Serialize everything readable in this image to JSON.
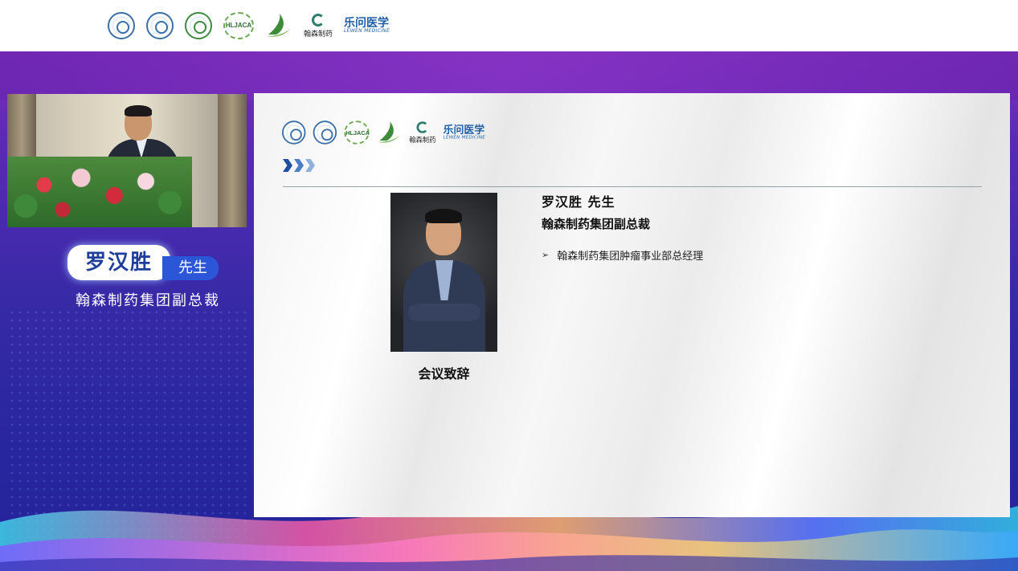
{
  "header": {
    "logos": [
      "seal-logo",
      "seal-logo",
      "seal-logo",
      "hljaca-logo",
      "leaf-logo",
      "hansoh-logo",
      "lewen-logo"
    ],
    "hljaca_text": "HLJACA",
    "hansoh_text": "翰森制药",
    "lewen_cn": "乐问医学",
    "lewen_en": "LEWEN MEDICINE"
  },
  "speaker_panel": {
    "name": "罗汉胜",
    "honorific": "先生",
    "title": "翰森制药集团副总裁"
  },
  "slide": {
    "caption": "会议致辞",
    "name_line": "罗汉胜  先生",
    "role": "翰森制药集团副总裁",
    "bullet_mark": "➢",
    "bullets": [
      "翰森制药集团肿瘤事业部总经理"
    ]
  },
  "colors": {
    "accent_blue": "#1f4fa0",
    "stage_purple": "#7a2fb8",
    "stage_blue": "#222399"
  }
}
